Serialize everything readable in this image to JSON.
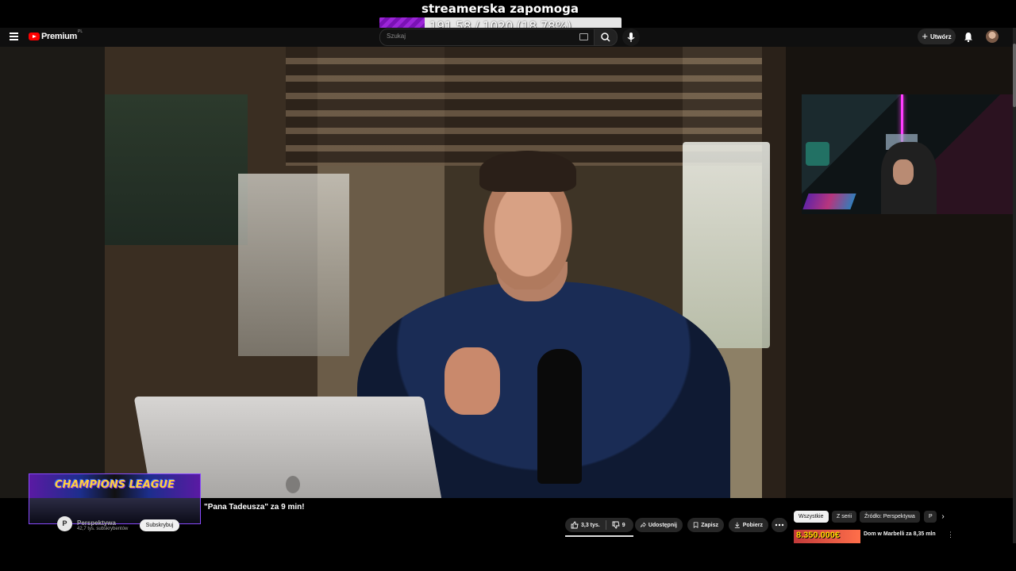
{
  "overlay": {
    "title": "streamerska zapomoga",
    "goal_text": "191.58 / 1020 (18.78%)",
    "goal_progress": 0.1878,
    "goal_fill_color": "#9c25d8"
  },
  "header": {
    "logo_text": "Premium",
    "logo_country": "PL",
    "search_placeholder": "Szukaj",
    "create_label": "Utwórz"
  },
  "champions": {
    "title": "CHAMPIONS LEAGUE"
  },
  "video": {
    "title": "\"Pana Tadeusza\" za 9 min!",
    "channel_initial": "P",
    "channel_name": "Perspektywa",
    "subscribers": "42,7 tys. subskrybentów",
    "subscribe_label": "Subskrybuj"
  },
  "actions": {
    "likes": "3,3 tys.",
    "dislikes": "9",
    "share": "Udostępnij",
    "save": "Zapisz",
    "download": "Pobierz"
  },
  "chips": [
    "Wszystkie",
    "Z serii",
    "Źródło: Perspektywa",
    "P"
  ],
  "recommendation": {
    "thumb_text": "8.350.000€",
    "title": "Dom w Marbelli za 8,35 mln"
  },
  "icons": {
    "menu": "hamburger-icon",
    "search": "search-icon",
    "mic": "mic-icon",
    "bell": "bell-icon",
    "like": "thumbs-up-icon",
    "dislike": "thumbs-down-icon",
    "share": "share-icon",
    "save": "bookmark-icon",
    "download": "download-icon",
    "more": "more-icon"
  }
}
